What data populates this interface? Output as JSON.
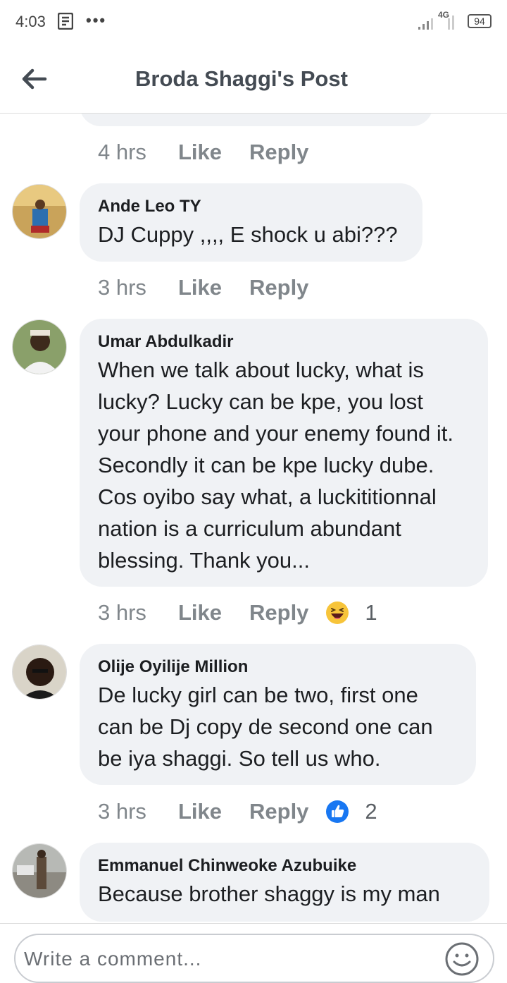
{
  "status_bar": {
    "time": "4:03",
    "network": "4G",
    "battery": "94"
  },
  "header": {
    "title": "Broda Shaggi's Post"
  },
  "top_meta": {
    "time": "4 hrs",
    "like": "Like",
    "reply": "Reply"
  },
  "comments": [
    {
      "name": "Ande Leo TY",
      "text": "DJ Cuppy ,,,, E shock u abi???",
      "time": "3 hrs",
      "like": "Like",
      "reply": "Reply"
    },
    {
      "name": "Umar Abdulkadir",
      "text": "When we talk about lucky, what is lucky? Lucky can be kpe, you lost your phone and your enemy found it. Secondly it can be kpe lucky dube. Cos oyibo say what, a luckititionnal nation is a curriculum abundant blessing. Thank you...",
      "time": "3 hrs",
      "like": "Like",
      "reply": "Reply",
      "reaction_icon": "haha-emoji-icon",
      "reaction_count": "1"
    },
    {
      "name": "Olije Oyilije Million",
      "text": "De lucky girl can be two, first one can be Dj copy de second one can be iya shaggi. So tell us who.",
      "time": "3 hrs",
      "like": "Like",
      "reply": "Reply",
      "reaction_icon": "like-thumb-icon",
      "reaction_count": "2"
    },
    {
      "name": "Emmanuel Chinweoke Azubuike",
      "text": "Because brother shaggy is my man"
    }
  ],
  "composer": {
    "placeholder": "Write a comment..."
  },
  "colors": {
    "bubble": "#f0f2f5",
    "meta": "#80868b",
    "like_blue": "#1877f2",
    "haha_yellow": "#f7c43a"
  }
}
